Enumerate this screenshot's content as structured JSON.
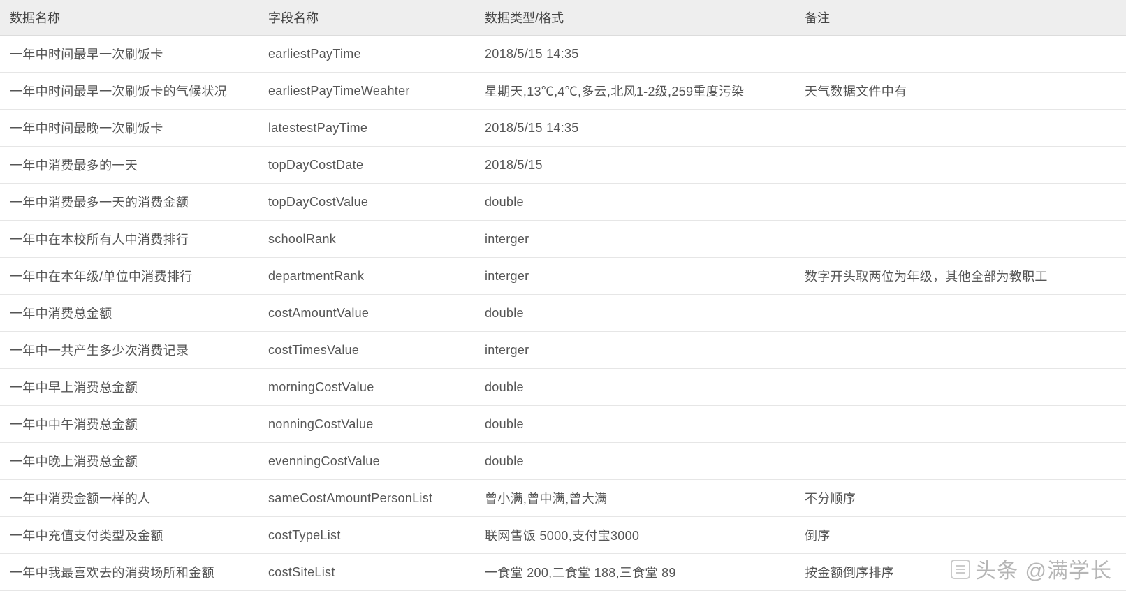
{
  "table": {
    "headers": [
      "数据名称",
      "字段名称",
      "数据类型/格式",
      "备注"
    ],
    "rows": [
      {
        "c0": "一年中时间最早一次刷饭卡",
        "c1": "earliestPayTime",
        "c2": "2018/5/15 14:35",
        "c3": ""
      },
      {
        "c0": "一年中时间最早一次刷饭卡的气候状况",
        "c1": "earliestPayTimeWeahter",
        "c2": "星期天,13℃,4℃,多云,北风1-2级,259重度污染",
        "c3": "天气数据文件中有"
      },
      {
        "c0": "一年中时间最晚一次刷饭卡",
        "c1": "latestestPayTime",
        "c2": "2018/5/15 14:35",
        "c3": ""
      },
      {
        "c0": "一年中消费最多的一天",
        "c1": "topDayCostDate",
        "c2": "2018/5/15",
        "c3": ""
      },
      {
        "c0": "一年中消费最多一天的消费金额",
        "c1": "topDayCostValue",
        "c2": "double",
        "c3": ""
      },
      {
        "c0": "一年中在本校所有人中消费排行",
        "c1": "schoolRank",
        "c2": "interger",
        "c3": ""
      },
      {
        "c0": "一年中在本年级/单位中消费排行",
        "c1": "departmentRank",
        "c2": "interger",
        "c3": "数字开头取两位为年级，其他全部为教职工"
      },
      {
        "c0": "一年中消费总金额",
        "c1": "costAmountValue",
        "c2": "double",
        "c3": ""
      },
      {
        "c0": "一年中一共产生多少次消费记录",
        "c1": "costTimesValue",
        "c2": "interger",
        "c3": ""
      },
      {
        "c0": "一年中早上消费总金额",
        "c1": "morningCostValue",
        "c2": "double",
        "c3": ""
      },
      {
        "c0": "一年中中午消费总金额",
        "c1": "nonningCostValue",
        "c2": "double",
        "c3": ""
      },
      {
        "c0": "一年中晚上消费总金额",
        "c1": "evenningCostValue",
        "c2": "double",
        "c3": ""
      },
      {
        "c0": "一年中消费金额一样的人",
        "c1": "sameCostAmountPersonList",
        "c2": "曾小满,曾中满,曾大满",
        "c3": "不分顺序"
      },
      {
        "c0": "一年中充值支付类型及金额",
        "c1": "costTypeList",
        "c2": "联网售饭 5000,支付宝3000",
        "c3": "倒序"
      },
      {
        "c0": "一年中我最喜欢去的消费场所和金额",
        "c1": "costSiteList",
        "c2": "一食堂 200,二食堂 188,三食堂 89",
        "c3": "按金额倒序排序"
      }
    ]
  },
  "watermark": "头条 @满学长"
}
